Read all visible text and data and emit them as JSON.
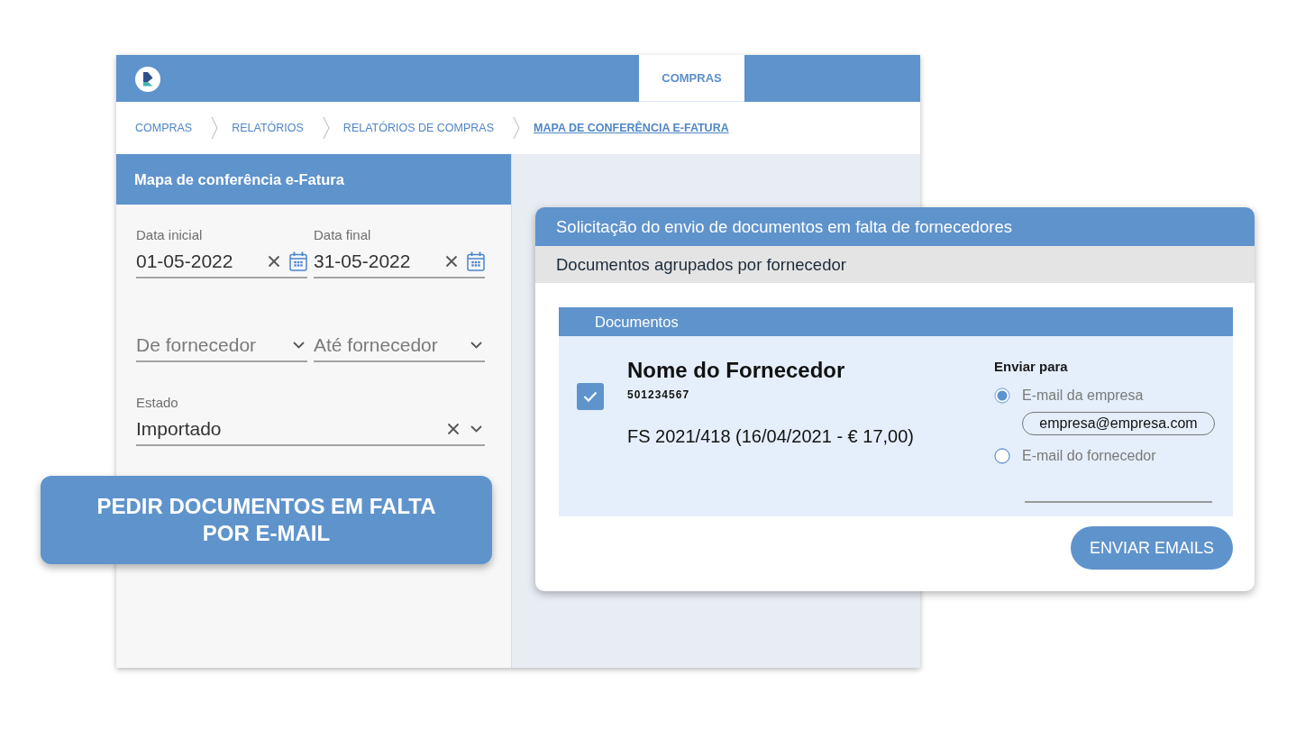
{
  "app": {
    "tabs": [
      {
        "label": "COMPRAS",
        "selected": true
      }
    ],
    "breadcrumb": [
      {
        "label": "COMPRAS",
        "current": false
      },
      {
        "label": "RELATÓRIOS",
        "current": false
      },
      {
        "label": "RELATÓRIOS DE COMPRAS",
        "current": false
      },
      {
        "label": "MAPA DE CONFERÊNCIA E-FATURA",
        "current": true
      }
    ],
    "panel": {
      "title": "Mapa de conferência e-Fatura",
      "filter_rows": [
        {
          "fields": [
            {
              "kind": "date",
              "label": "Data inicial",
              "value": "01-05-2022",
              "clearable": true
            },
            {
              "kind": "date",
              "label": "Data final",
              "value": "31-05-2022",
              "clearable": true
            }
          ]
        },
        {
          "fields": [
            {
              "kind": "select",
              "placeholder": "De fornecedor",
              "clearable": false
            },
            {
              "kind": "select",
              "placeholder": "Até fornecedor",
              "clearable": false
            }
          ]
        },
        {
          "fields": [
            {
              "kind": "select",
              "label": "Estado",
              "value": "Importado",
              "clearable": true
            }
          ]
        }
      ]
    }
  },
  "callout_button": {
    "label": "PEDIR DOCUMENTOS EM FALTA POR E-MAIL"
  },
  "dialog": {
    "title": "Solicitação do envio de documentos em falta de fornecedores",
    "subtitle": "Documentos agrupados por fornecedor",
    "section_title": "Documentos",
    "suppliers": [
      {
        "checked": true,
        "name": "Nome do Fornecedor",
        "tax_id": "501234567",
        "documents": [
          "FS 2021/418 (16/04/2021 - € 17,00)"
        ],
        "send_to": {
          "label": "Enviar para",
          "options": [
            {
              "label": "E-mail da empresa",
              "selected": true,
              "value": "empresa@empresa.com"
            },
            {
              "label": "E-mail do fornecedor",
              "selected": false
            }
          ]
        }
      }
    ],
    "button": "ENVIAR EMAILS"
  }
}
